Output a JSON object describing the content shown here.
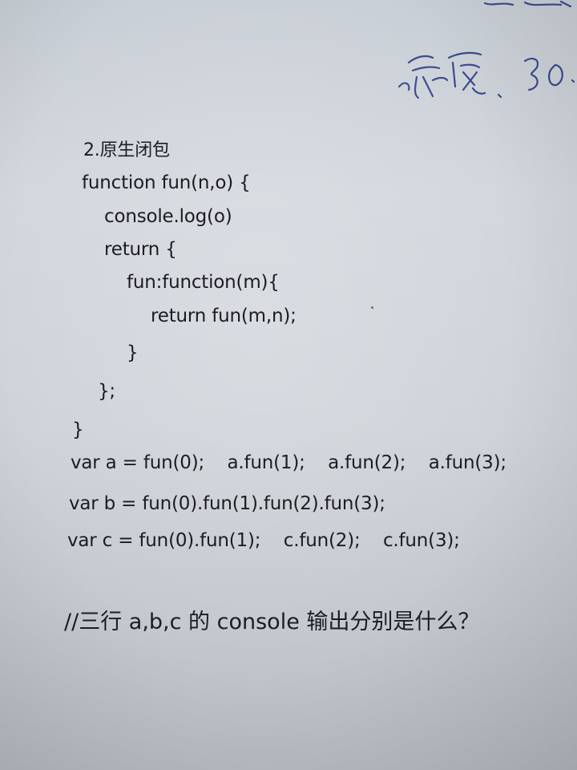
{
  "handwriting": {
    "text": "资质. 30."
  },
  "document": {
    "heading": "2.原生闭包",
    "code_lines": [
      "function fun(n,o) {",
      "console.log(o)",
      "return {",
      "fun:function(m){",
      "return fun(m,n);",
      "}",
      "};",
      "}",
      "var a = fun(0);    a.fun(1);    a.fun(2);    a.fun(3);",
      "var b = fun(0).fun(1).fun(2).fun(3);",
      "var c = fun(0).fun(1);    c.fun(2);    c.fun(3);"
    ],
    "question": "//三行 a,b,c 的 console 输出分别是什么？"
  }
}
